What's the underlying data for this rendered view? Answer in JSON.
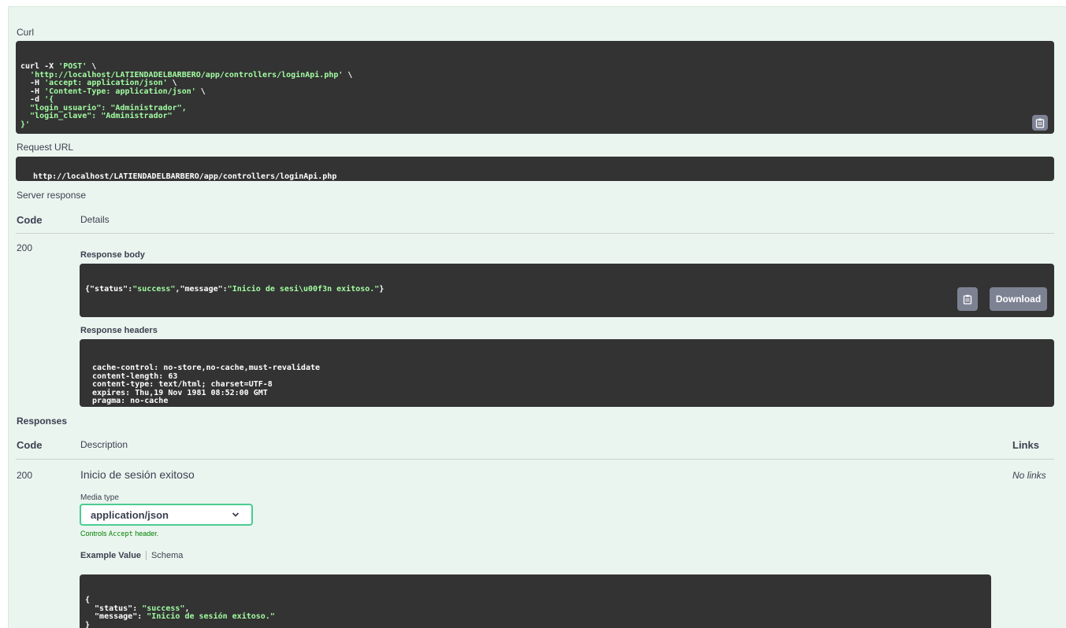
{
  "curl": {
    "label": "Curl",
    "lines": [
      [
        {
          "t": "curl -X ",
          "s": false
        },
        {
          "t": "'POST'",
          "s": true
        },
        {
          "t": " \\",
          "s": false
        }
      ],
      [
        {
          "t": "  ",
          "s": false
        },
        {
          "t": "'http://localhost/LATIENDADELBARBERO/app/controllers/loginApi.php'",
          "s": true
        },
        {
          "t": " \\",
          "s": false
        }
      ],
      [
        {
          "t": "  -H ",
          "s": false
        },
        {
          "t": "'accept: application/json'",
          "s": true
        },
        {
          "t": " \\",
          "s": false
        }
      ],
      [
        {
          "t": "  -H ",
          "s": false
        },
        {
          "t": "'Content-Type: application/json'",
          "s": true
        },
        {
          "t": " \\",
          "s": false
        }
      ],
      [
        {
          "t": "  -d ",
          "s": false
        },
        {
          "t": "'{",
          "s": true
        }
      ],
      [
        {
          "t": "  \"login_usuario\": \"Administrador\",",
          "s": true
        }
      ],
      [
        {
          "t": "  \"login_clave\": \"Administrador\"",
          "s": true
        }
      ],
      [
        {
          "t": "}'",
          "s": true
        }
      ]
    ]
  },
  "request_url": {
    "label": "Request URL",
    "value": "http://localhost/LATIENDADELBARBERO/app/controllers/loginApi.php"
  },
  "server_response": {
    "label": "Server response",
    "col_code": "Code",
    "col_details": "Details",
    "code": "200",
    "response_body_label": "Response body",
    "response_body": [
      {
        "t": "{",
        "s": false
      },
      {
        "t": "\"status\"",
        "s": false
      },
      {
        "t": ":",
        "s": false
      },
      {
        "t": "\"success\"",
        "s": true
      },
      {
        "t": ",",
        "s": false
      },
      {
        "t": "\"message\"",
        "s": false
      },
      {
        "t": ":",
        "s": false
      },
      {
        "t": "\"Inicio de sesi\\u00f3n exitoso.\"",
        "s": true
      },
      {
        "t": "}",
        "s": false
      }
    ],
    "download_label": "Download",
    "response_headers_label": "Response headers",
    "response_headers": [
      " cache-control: no-store,no-cache,must-revalidate ",
      " content-length: 63 ",
      " content-type: text/html; charset=UTF-8 ",
      " expires: Thu,19 Nov 1981 08:52:00 GMT ",
      " pragma: no-cache "
    ]
  },
  "responses": {
    "label": "Responses",
    "col_code": "Code",
    "col_description": "Description",
    "col_links": "Links",
    "code": "200",
    "description": "Inicio de sesión exitoso",
    "links": "No links",
    "media_type_label": "Media type",
    "media_type_value": "application/json",
    "controls_prefix": "Controls ",
    "controls_code": "Accept",
    "controls_suffix": " header.",
    "example_value_tab": "Example Value",
    "schema_tab": "Schema",
    "example_lines": [
      [
        {
          "t": "{",
          "s": false
        }
      ],
      [
        {
          "t": "  \"status\": ",
          "s": false
        },
        {
          "t": "\"success\"",
          "s": true
        },
        {
          "t": ",",
          "s": false
        }
      ],
      [
        {
          "t": "  \"message\": ",
          "s": false
        },
        {
          "t": "\"Inicio de sesión exitoso.\"",
          "s": true
        }
      ],
      [
        {
          "t": "}",
          "s": false
        }
      ]
    ]
  },
  "icons": {
    "copy": "clipboard-copy-icon",
    "chevron": "chevron-down-icon"
  },
  "colors": {
    "panel_bg": "#ebf5ef",
    "code_bg": "#333333",
    "string_green": "#a2fca2",
    "select_border": "#49cc90",
    "button_gray": "#7d8293"
  }
}
